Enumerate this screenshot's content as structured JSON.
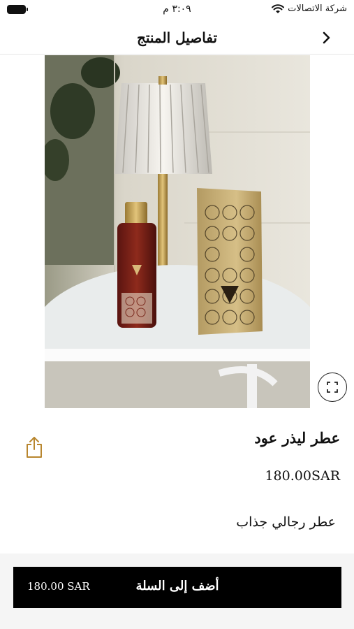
{
  "status_bar": {
    "carrier": "شركة الاتصالات",
    "time": "٣:٠٩ م"
  },
  "header": {
    "title": "تفاصيل المنتج"
  },
  "product": {
    "name": "عطر ليذر عود",
    "price": "180.00SAR",
    "description": "عطر رجالي جذاب"
  },
  "cart_bar": {
    "button_label": "أضف إلى السلة",
    "price": "180.00 SAR"
  },
  "icons": {
    "back": "chevron-right-icon",
    "expand": "expand-icon",
    "share": "share-icon"
  },
  "colors": {
    "accent": "#b8862e",
    "button_bg": "#000000",
    "button_text": "#ffffff"
  }
}
